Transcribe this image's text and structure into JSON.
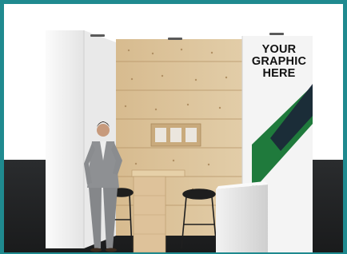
{
  "image": {
    "subject": "trade-show-booth-render",
    "graphic_panel_text": "YOUR\nGRAPHIC\nHERE",
    "colors": {
      "frame_border": "#1f8a8f",
      "background_wall": "#ffffff",
      "floor": "#222426",
      "wood_panel": "#dcc39a",
      "wall_panel": "#f2f2f2",
      "graphic_green": "#1f7a3c",
      "graphic_navy": "#1b2638",
      "suit": "#8e9093"
    }
  }
}
